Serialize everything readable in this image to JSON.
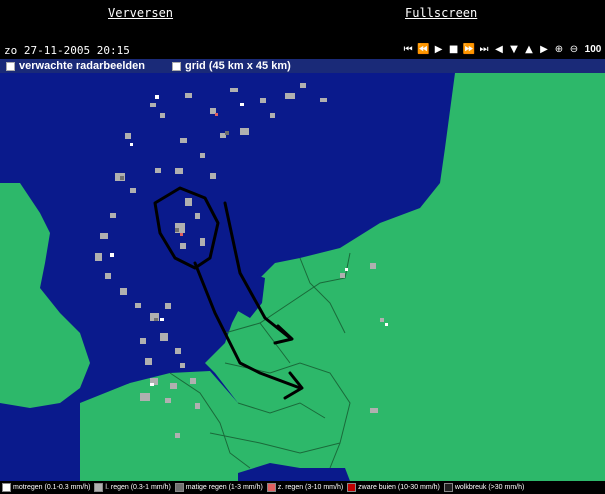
{
  "header": {
    "refresh_label": "Verversen",
    "fullscreen_label": "Fullscreen"
  },
  "status": {
    "timestamp": "zo 27-11-2005 20:15",
    "zoom": "100"
  },
  "controls": [
    {
      "name": "first-frame-icon",
      "glyph": "⏮"
    },
    {
      "name": "rewind-icon",
      "glyph": "⏪"
    },
    {
      "name": "play-icon",
      "glyph": "▶"
    },
    {
      "name": "stop-icon",
      "glyph": "■"
    },
    {
      "name": "fast-forward-icon",
      "glyph": "⏩"
    },
    {
      "name": "last-frame-icon",
      "glyph": "⏭"
    },
    {
      "name": "pan-left-icon",
      "glyph": "◀"
    },
    {
      "name": "pan-down-icon",
      "glyph": "▼"
    },
    {
      "name": "pan-up-icon",
      "glyph": "▲"
    },
    {
      "name": "pan-right-icon",
      "glyph": "▶"
    },
    {
      "name": "zoom-in-icon",
      "glyph": "⊕"
    },
    {
      "name": "zoom-out-icon",
      "glyph": "⊖"
    }
  ],
  "options": {
    "forecast_label": "verwachte radarbeelden",
    "grid_label": "grid (45 km x 45 km)"
  },
  "legend": [
    {
      "label": "motregen (0.1-0.3 mm/h)",
      "color": "#ffffff"
    },
    {
      "label": "l. regen (0.3-1 mm/h)",
      "color": "#b0b0b0"
    },
    {
      "label": "matige regen (1-3 mm/h)",
      "color": "#707070"
    },
    {
      "label": "z. regen (3-10 mm/h)",
      "color": "#e06060"
    },
    {
      "label": "zware buien (10-30 mm/h)",
      "color": "#c00000"
    },
    {
      "label": "wolkbreuk (>30 mm/h)",
      "color": "#202020"
    }
  ],
  "colors": {
    "sea": "#0a1a8c",
    "land": "#2db86a",
    "border": "#1a6a3a",
    "annotation": "#000000"
  }
}
